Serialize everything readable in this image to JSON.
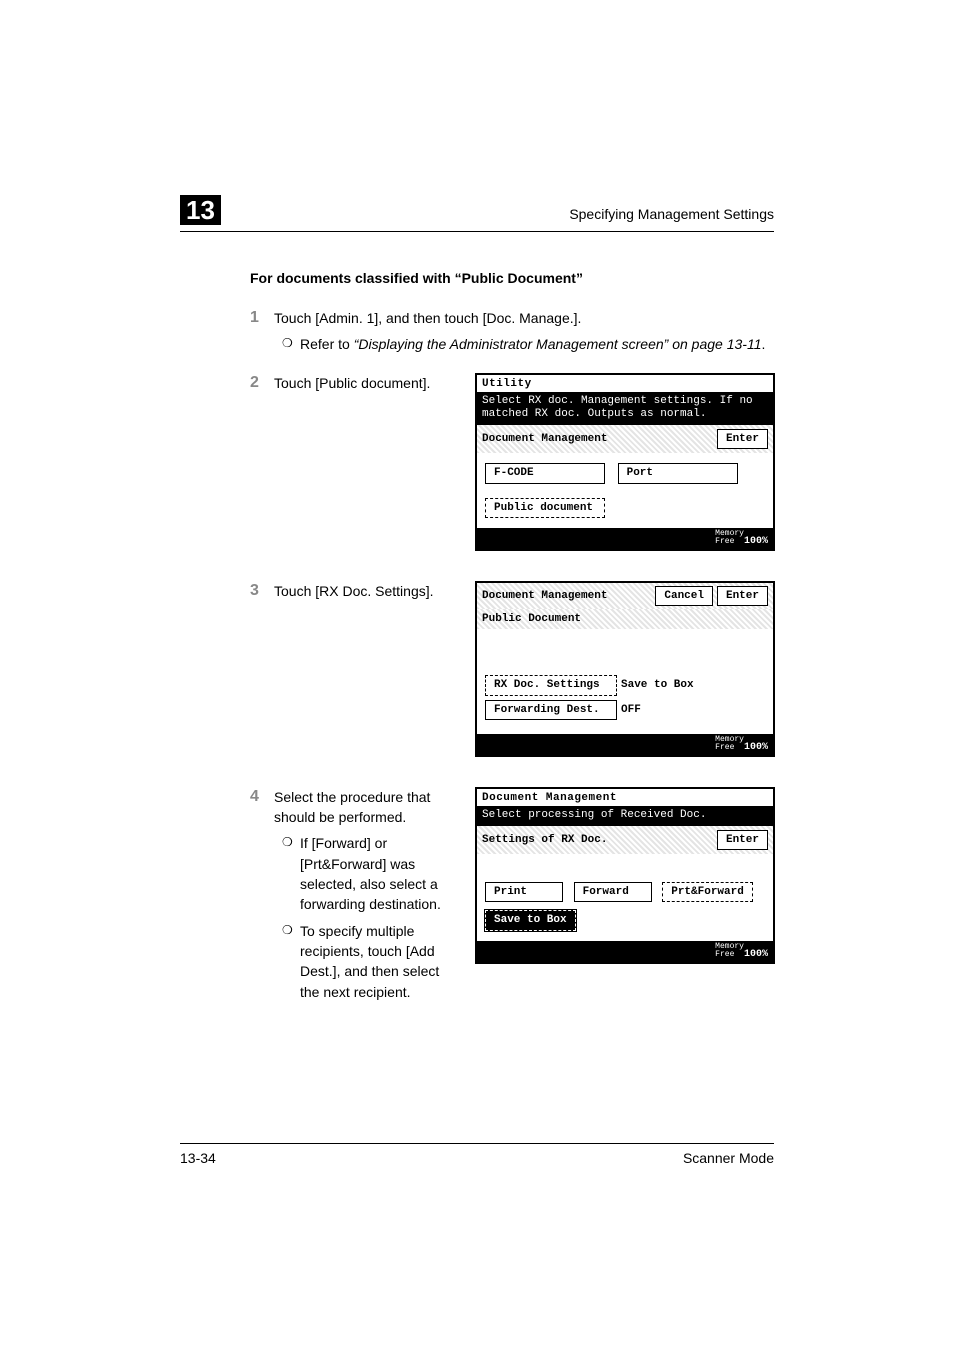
{
  "header": {
    "chapter_number": "13",
    "section": "Specifying Management Settings"
  },
  "section_title": "For documents classified with “Public Document”",
  "steps": {
    "s1": {
      "num": "1",
      "text": "Touch [Admin. 1], and then touch [Doc. Manage.].",
      "sub_ref": "Refer to ",
      "sub_em": "“Displaying the Administrator Management screen” on page 13-11",
      "sub_tail": "."
    },
    "s2": {
      "num": "2",
      "text": "Touch [Public document]."
    },
    "s3": {
      "num": "3",
      "text": "Touch [RX Doc. Settings]."
    },
    "s4": {
      "num": "4",
      "text": "Select the procedure that should be performed.",
      "sub_a": "If [Forward] or [Prt&Forward] was selected, also select a forwarding destination.",
      "sub_b": "To specify multiple recipients, touch [Add Dest.], and then select the next recipient."
    }
  },
  "bullet": "❍",
  "screens": {
    "a": {
      "title": "Utility",
      "msg": "Select RX doc. Management settings. If no matched RX doc. Outputs as normal.",
      "band_label": "Document Management",
      "enter": "Enter",
      "btn_fcode": "F-CODE",
      "btn_port": "Port",
      "btn_public": "Public document"
    },
    "b": {
      "title": "Document Management",
      "cancel": "Cancel",
      "enter": "Enter",
      "sub": "Public Document",
      "rx_label": "RX Doc. Settings",
      "rx_val": "Save to Box",
      "fd_label": "Forwarding Dest.",
      "fd_val": "OFF"
    },
    "c": {
      "title": "Document Management",
      "msg": "Select processing of Received Doc.",
      "band_label": "Settings of RX Doc.",
      "enter": "Enter",
      "print": "Print",
      "forward": "Forward",
      "prtfwd": "Prt&Forward",
      "save": "Save to Box"
    },
    "mem_label": "Memory",
    "mem_free": "Free",
    "mem_val": "100%"
  },
  "footer": {
    "page": "13-34",
    "mode": "Scanner Mode"
  }
}
